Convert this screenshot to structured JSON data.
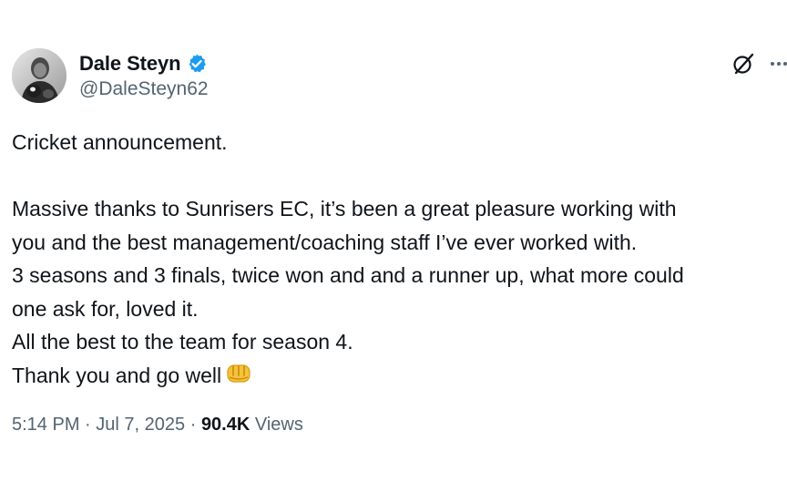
{
  "author": {
    "display_name": "Dale Steyn",
    "handle": "@DaleSteyn62",
    "verified": true,
    "avatar_icon": "profile-photo"
  },
  "header_actions": {
    "grok_icon": "grok-icon",
    "more_icon": "more-options-icon"
  },
  "tweet": {
    "lines": [
      "Cricket announcement.",
      "",
      "Massive thanks to Sunrisers EC, it’s been a great pleasure working with",
      "you and the best management/coaching staff I’ve ever worked with.",
      "3 seasons and 3 finals, twice won and and a runner up, what more could",
      "one ask for, loved it.",
      "All the best to the team for season 4.",
      "Thank you and go well"
    ],
    "emoji": "oncoming-fist"
  },
  "meta": {
    "time": "5:14 PM",
    "separator": "·",
    "date": "Jul 7, 2025",
    "views_count": "90.4K",
    "views_label": "Views"
  },
  "colors": {
    "text": "#0f1419",
    "secondary": "#536471",
    "verified_blue": "#1d9bf0"
  }
}
